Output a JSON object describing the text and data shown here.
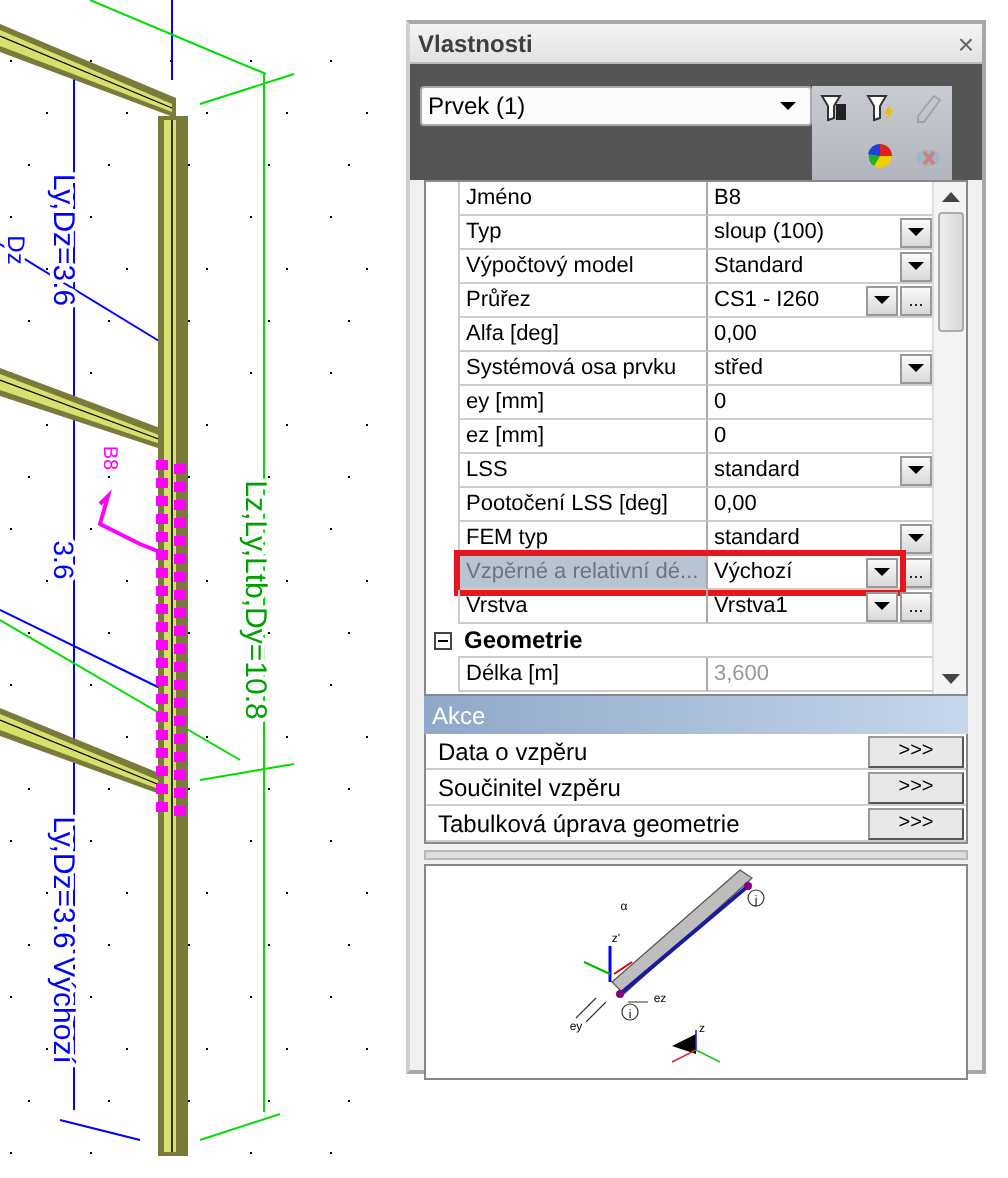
{
  "canvas": {
    "labels": [
      {
        "text": "Ly,Dz=3.6",
        "color": "#0000ff"
      },
      {
        "text": "Dz",
        "color": "#0000ff"
      },
      {
        "text": "3.6",
        "color": "#0000ff"
      },
      {
        "text": "B8",
        "color": "#ff00ff"
      },
      {
        "text": "Lz,Ly,Ltb,Dy=10.8",
        "color": "#00a000"
      },
      {
        "text": "Ly,Dz=3.6 Výchozí",
        "color": "#0000ff"
      }
    ]
  },
  "panel": {
    "title": "Vlastnosti",
    "close": "×",
    "selector": {
      "value": "Prvek (1)"
    },
    "tools": [
      {
        "kind": "filter_table",
        "disabled": false
      },
      {
        "kind": "filter_lightning",
        "disabled": false
      },
      {
        "kind": "pencil",
        "disabled": true
      },
      {
        "kind": "pie",
        "disabled": false
      },
      {
        "kind": "cancel",
        "disabled": true
      }
    ],
    "rows": [
      {
        "kind": "property",
        "name": "Jméno",
        "value": "B8",
        "dropdown": false,
        "selected": false,
        "outlined": false,
        "readonly": false
      },
      {
        "kind": "property",
        "name": "Typ",
        "value": "sloup (100)",
        "dropdown": true,
        "selected": false,
        "outlined": false,
        "readonly": false
      },
      {
        "kind": "property",
        "name": "Výpočtový model",
        "value": "Standard",
        "dropdown": true,
        "selected": false,
        "outlined": false,
        "readonly": false
      },
      {
        "kind": "property",
        "name": "Průřez",
        "value": "CS1 - I260",
        "dropdown": true,
        "more": "...",
        "selected": false,
        "outlined": false,
        "readonly": false
      },
      {
        "kind": "property",
        "name": "Alfa [deg]",
        "value": "0,00",
        "dropdown": false,
        "selected": false,
        "outlined": false,
        "readonly": false
      },
      {
        "kind": "property",
        "name": "Systémová osa prvku",
        "value": "střed",
        "dropdown": true,
        "selected": false,
        "outlined": false,
        "readonly": false
      },
      {
        "kind": "property",
        "name": "ey [mm]",
        "value": "0",
        "dropdown": false,
        "selected": false,
        "outlined": false,
        "readonly": false
      },
      {
        "kind": "property",
        "name": "ez [mm]",
        "value": "0",
        "dropdown": false,
        "selected": false,
        "outlined": false,
        "readonly": false
      },
      {
        "kind": "property",
        "name": "LSS",
        "value": "standard",
        "dropdown": true,
        "selected": false,
        "outlined": false,
        "readonly": false
      },
      {
        "kind": "property",
        "name": "Pootočení LSS [deg]",
        "value": "0,00",
        "dropdown": false,
        "selected": false,
        "outlined": false,
        "readonly": false
      },
      {
        "kind": "property",
        "name": "FEM typ",
        "value": "standard",
        "dropdown": true,
        "selected": false,
        "outlined": false,
        "readonly": false
      },
      {
        "kind": "property",
        "name": "Vzpěrné a relativní dé...",
        "value": "Výchozí",
        "dropdown": true,
        "more": "...",
        "selected": true,
        "outlined": true,
        "readonly": false
      },
      {
        "kind": "property",
        "name": "Vrstva",
        "value": "Vrstva1",
        "dropdown": true,
        "more": "...",
        "selected": false,
        "outlined": false,
        "readonly": false
      },
      {
        "kind": "group",
        "name": "Geometrie",
        "expanded": true
      },
      {
        "kind": "property",
        "name": "Délka [m]",
        "value": "3,600",
        "dropdown": false,
        "selected": false,
        "outlined": false,
        "readonly": true
      }
    ],
    "actions": {
      "title": "Akce",
      "items": [
        {
          "label": "Data o vzpěru",
          "button": ">>>"
        },
        {
          "label": "Součinitel vzpěru",
          "button": ">>>"
        },
        {
          "label": "Tabulková úprava geometrie",
          "button": ">>>"
        }
      ]
    },
    "preview": {
      "labels": [
        "α",
        "z'",
        "i",
        "j",
        "ez",
        "ey",
        "z"
      ]
    }
  }
}
